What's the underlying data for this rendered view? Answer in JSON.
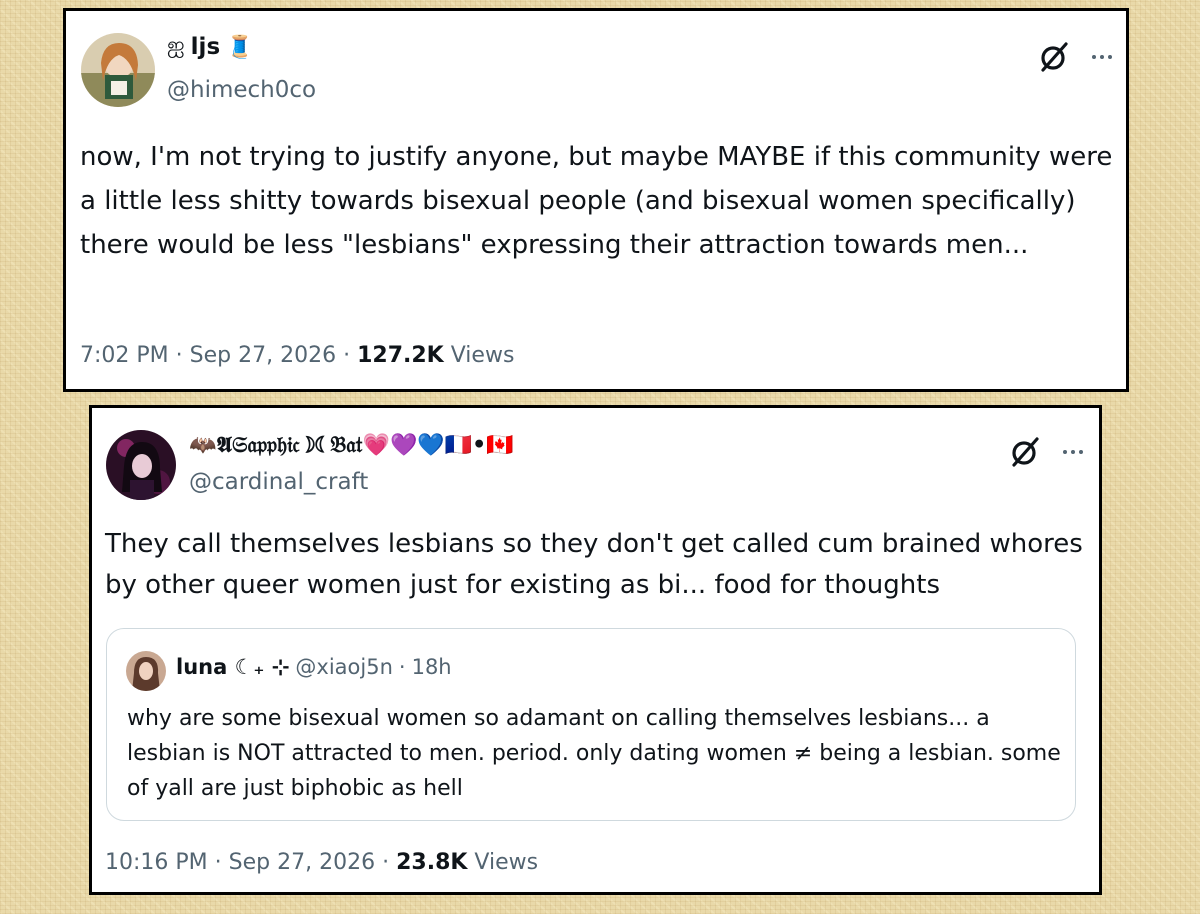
{
  "tweet1": {
    "display_name": "ljs",
    "name_prefix_emoji": "ஐ",
    "name_suffix_emoji": "🧵",
    "handle": "@himech0co",
    "text": "now, I'm not trying to justify anyone, but maybe MAYBE if this community were a little less shitty towards bisexual people (and bisexual women specifically) there would be less \"lesbians\" expressing their attraction towards men...",
    "time": "7:02 PM",
    "date": "Sep 27, 2026",
    "views_count": "127.2K",
    "views_label": "Views",
    "grok_icon": "grok-icon",
    "more_icon": "more-icon"
  },
  "tweet2": {
    "display_name": "🦇𝕬𝔖𝔞𝔭𝔭𝔥𝔦𝔠☽☾𝔅𝔞𝔱💗💜💙🇫🇷•🇨🇦",
    "handle": "@cardinal_craft",
    "text": "They call themselves lesbians so they don't get called cum brained whores by other queer women just for existing as bi... food for thoughts",
    "time": "10:16 PM",
    "date": "Sep 27, 2026",
    "views_count": "23.8K",
    "views_label": "Views",
    "quote": {
      "display_name": "luna ☾₊ ⊹",
      "handle": "@xiaoj5n",
      "time_ago": "18h",
      "text": "why are some bisexual women so adamant on calling themselves lesbians... a lesbian is NOT attracted to men. period. only dating women ≠ being a lesbian. some of yall are just biphobic as hell"
    }
  },
  "separator": "·"
}
